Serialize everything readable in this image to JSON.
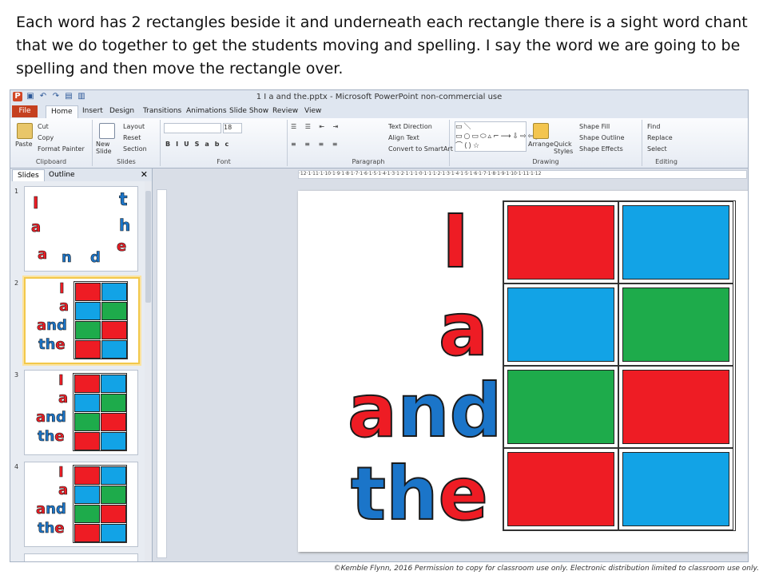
{
  "caption": "Each word has 2 rectangles beside it and underneath each rectangle there is a sight word chant that we do together to get the students moving and spelling. I say the word we are going to be spelling and then move the rectangle over.",
  "footer": "©Kemble Flynn, 2016 Permission to copy for classroom use only.  Electronic distribution limited to classroom use only.",
  "window": {
    "title": "1 I a and the.pptx - Microsoft PowerPoint non-commercial use"
  },
  "tabs": [
    "File",
    "Home",
    "Insert",
    "Design",
    "Transitions",
    "Animations",
    "Slide Show",
    "Review",
    "View"
  ],
  "ribbon": {
    "clipboard": {
      "paste": "Paste",
      "cut": "Cut",
      "copy": "Copy",
      "format_painter": "Format Painter",
      "label": "Clipboard"
    },
    "slides": {
      "new_slide": "New Slide",
      "layout": "Layout",
      "reset": "Reset",
      "section": "Section",
      "label": "Slides"
    },
    "font": {
      "size": "18",
      "label": "Font"
    },
    "paragraph": {
      "text_direction": "Text Direction",
      "align_text": "Align Text",
      "convert": "Convert to SmartArt",
      "label": "Paragraph"
    },
    "drawing": {
      "arrange": "Arrange",
      "quick_styles": "Quick Styles",
      "shape_fill": "Shape Fill",
      "shape_outline": "Shape Outline",
      "shape_effects": "Shape Effects",
      "label": "Drawing"
    },
    "editing": {
      "find": "Find",
      "replace": "Replace",
      "select": "Select",
      "label": "Editing"
    }
  },
  "left_pane": {
    "tabs": [
      "Slides",
      "Outline"
    ],
    "close": "✕"
  },
  "slide_numbers": [
    "1",
    "2",
    "3",
    "4"
  ],
  "thumb1_letters": [
    "I",
    "a",
    "t",
    "h",
    "e",
    "a",
    "n",
    "d"
  ],
  "words": [
    "I",
    "a",
    "and",
    "the"
  ],
  "word_parts": {
    "and_a": "a",
    "and_nd": "nd",
    "the_th": "th",
    "the_e": "e"
  },
  "colors": {
    "red": "#ee1c24",
    "blue": "#1b75c9",
    "green": "#1eab4b",
    "light_blue": "#12a3e6"
  },
  "grid_colors": [
    [
      "red",
      "light_blue"
    ],
    [
      "light_blue",
      "green"
    ],
    [
      "green",
      "red"
    ],
    [
      "red",
      "light_blue"
    ]
  ],
  "ruler": "·12·1·11·1·10·1·9·1·8·1·7·1·6·1·5·1·4·1·3·1·2·1·1·1·0·1·1·1·2·1·3·1·4·1·5·1·6·1·7·1·8·1·9·1·10·1·11·1·12"
}
